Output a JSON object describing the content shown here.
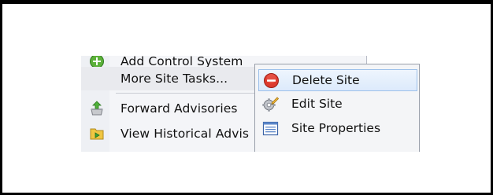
{
  "main_menu": {
    "items": [
      {
        "label": "Add Control System",
        "icon": "add-control-system-icon"
      },
      {
        "label": "More Site Tasks...",
        "icon": ""
      },
      {
        "label": "Forward Advisories",
        "icon": "forward-advisories-icon"
      },
      {
        "label": "View Historical Advis",
        "icon": "view-historical-icon"
      }
    ]
  },
  "submenu": {
    "items": [
      {
        "label": "Delete Site",
        "icon": "delete-icon",
        "highlighted": true
      },
      {
        "label": "Edit Site",
        "icon": "edit-gear-icon",
        "highlighted": false
      },
      {
        "label": "Site Properties",
        "icon": "properties-list-icon",
        "highlighted": false
      }
    ]
  },
  "colors": {
    "highlight_border": "#9cc0ea",
    "highlight_fill": "#dceafc",
    "delete_icon": "#d9382c"
  }
}
